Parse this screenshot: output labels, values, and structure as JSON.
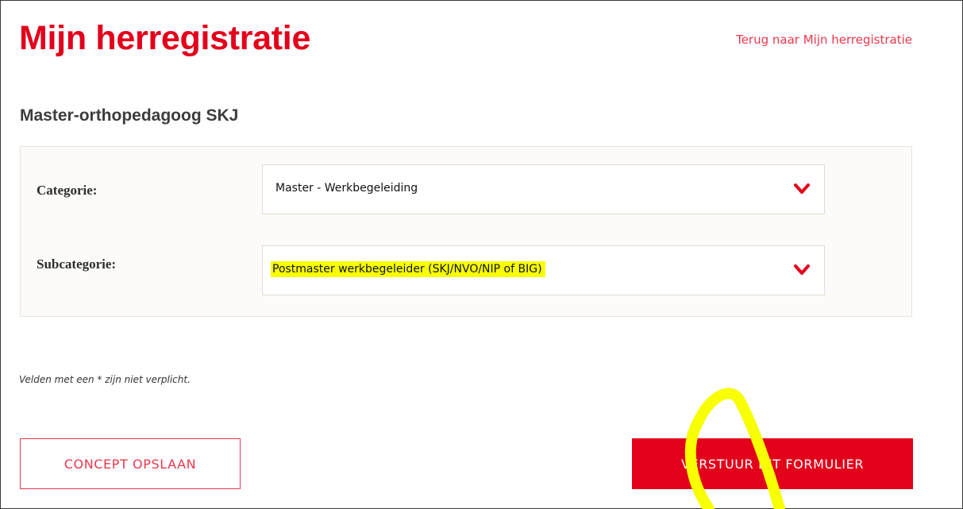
{
  "header": {
    "title": "Mijn herregistratie",
    "back_link": "Terug naar Mijn herregistratie"
  },
  "subtitle": "Master-orthopedagoog SKJ",
  "form": {
    "category_label": "Categorie:",
    "category_value": "Master - Werkbegeleiding",
    "subcategory_label": "Subcategorie:",
    "subcategory_value": "Postmaster werkbegeleider (SKJ/NVO/NIP of BIG)"
  },
  "note": "Velden met een * zijn niet verplicht.",
  "buttons": {
    "concept": "CONCEPT OPSLAAN",
    "submit": "VERSTUUR DIT FORMULIER"
  },
  "icons": {
    "dropdown": "chevron-down-icon"
  },
  "colors": {
    "brand_red": "#e3001b",
    "highlight_yellow": "#f7ff00"
  }
}
